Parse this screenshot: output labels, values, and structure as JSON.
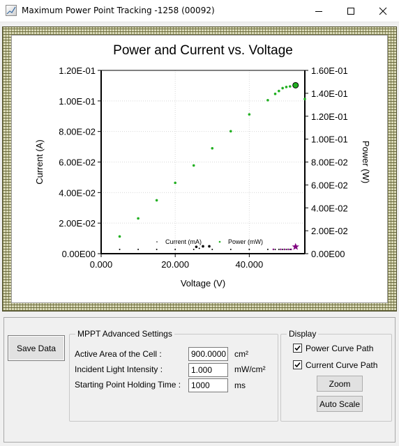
{
  "window": {
    "title": "Maximum Power Point Tracking -1258 (00092)",
    "minimize_icon": "minimize-icon",
    "maximize_icon": "maximize-icon",
    "close_icon": "close-icon"
  },
  "chart_data": {
    "type": "scatter",
    "title": "Power and Current vs. Voltage",
    "xlabel": "Voltage (V)",
    "ylabel": "Current (A)",
    "y2label": "Power (W)",
    "xlim": [
      0,
      55
    ],
    "ylim": [
      0,
      0.12
    ],
    "y2lim": [
      0,
      0.16
    ],
    "x_ticks": [
      "0.000",
      "20.000",
      "40.000"
    ],
    "x_tick_values": [
      0,
      20,
      40
    ],
    "y_ticks": [
      "0.00E00",
      "2.00E-02",
      "4.00E-02",
      "6.00E-02",
      "8.00E-02",
      "1.00E-01",
      "1.20E-01"
    ],
    "y_tick_values": [
      0,
      0.02,
      0.04,
      0.06,
      0.08,
      0.1,
      0.12
    ],
    "y2_ticks": [
      "0.00E00",
      "2.00E-02",
      "4.00E-02",
      "6.00E-02",
      "8.00E-02",
      "1.00E-01",
      "1.20E-01",
      "1.40E-01",
      "1.60E-01"
    ],
    "y2_tick_values": [
      0,
      0.02,
      0.04,
      0.06,
      0.08,
      0.1,
      0.12,
      0.14,
      0.16
    ],
    "grid": true,
    "legend": "bottom-center",
    "series": [
      {
        "name": "Current (mA)",
        "axis": "left",
        "color": "#000000",
        "points": [
          [
            5,
            0.0028
          ],
          [
            10,
            0.0028
          ],
          [
            15,
            0.0028
          ],
          [
            20,
            0.0028
          ],
          [
            25,
            0.0028
          ],
          [
            25.7,
            0.0045
          ],
          [
            26.5,
            0.0035
          ],
          [
            27.5,
            0.0048
          ],
          [
            29.2,
            0.0048
          ],
          [
            30,
            0.0028
          ],
          [
            35,
            0.0028
          ],
          [
            40,
            0.0028
          ],
          [
            45,
            0.0028
          ],
          [
            47,
            0.0028
          ],
          [
            48,
            0.0028
          ],
          [
            49,
            0.0028
          ],
          [
            50,
            0.0028
          ],
          [
            51,
            0.0028
          ]
        ]
      },
      {
        "name": "Power (mW)",
        "axis": "right",
        "color": "#22b022",
        "points": [
          [
            5,
            0.015
          ],
          [
            10,
            0.0308
          ],
          [
            15,
            0.0466
          ],
          [
            20,
            0.0618
          ],
          [
            25,
            0.077
          ],
          [
            30,
            0.092
          ],
          [
            35,
            0.1069
          ],
          [
            40,
            0.1216
          ],
          [
            45,
            0.134
          ],
          [
            47,
            0.1395
          ],
          [
            48,
            0.142
          ],
          [
            49,
            0.1445
          ],
          [
            50,
            0.1455
          ],
          [
            51,
            0.146
          ],
          [
            52.5,
            0.147
          ],
          [
            55,
            0.135
          ]
        ]
      }
    ],
    "markers": [
      {
        "name": "max-power-point",
        "axis": "right",
        "x": 52.5,
        "y": 0.147,
        "color": "#22b022"
      },
      {
        "name": "start-point-star",
        "axis": "left",
        "x": 52.5,
        "y": 0.0045,
        "color": "#800080"
      }
    ],
    "purple_points": [
      [
        46.5,
        0.0028
      ],
      [
        48.5,
        0.0028
      ],
      [
        49.5,
        0.0028
      ],
      [
        50.5,
        0.0028
      ],
      [
        51.3,
        0.0028
      ]
    ]
  },
  "controls": {
    "save_data_label": "Save Data",
    "mppt_group_title": "MPPT Advanced Settings",
    "active_area_label": "Active Area of the Cell :",
    "active_area_value": "900.0000",
    "active_area_unit": "cm²",
    "light_intensity_label": "Incident Light Intensity :",
    "light_intensity_value": "1.000",
    "light_intensity_unit": "mW/cm²",
    "holding_time_label": "Starting Point Holding Time :",
    "holding_time_value": "1000",
    "holding_time_unit": "ms",
    "display_group_title": "Display",
    "power_curve_label": "Power Curve Path",
    "power_curve_checked": true,
    "current_curve_label": "Current Curve Path",
    "current_curve_checked": true,
    "zoom_label": "Zoom",
    "auto_scale_label": "Auto Scale"
  }
}
